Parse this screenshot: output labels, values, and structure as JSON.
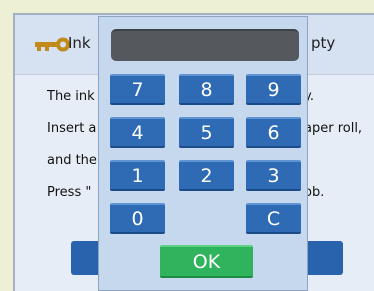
{
  "dialog": {
    "title_left": "Ink",
    "title_right": "pty",
    "line1": "The ink",
    "line2_left": "Insert a",
    "line2_right": "aper roll,",
    "line3": "and the",
    "line4_left": "Press \"",
    "line4_right": "ob.",
    "line1_right": "y.",
    "icon": "key-icon"
  },
  "keypad": {
    "display_value": "",
    "keys": [
      "7",
      "8",
      "9",
      "4",
      "5",
      "6",
      "1",
      "2",
      "3",
      "0",
      "C"
    ],
    "ok_label": "OK"
  },
  "colors": {
    "key_blue": "#2f6bb4",
    "ok_green": "#2fb35c",
    "display": "#55595e",
    "keypad_bg": "#c6d8ee"
  }
}
